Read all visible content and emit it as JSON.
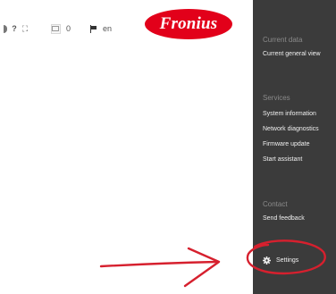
{
  "header": {
    "toolbar": {
      "help_label": "?",
      "fullscreen_label": "⛶",
      "message_count": "0",
      "language_label": "en"
    },
    "logo_text": "Fronius",
    "brand_color": "#e2001a"
  },
  "sidebar": {
    "sections": [
      {
        "caption": "Current data",
        "items": [
          "Current general view"
        ]
      },
      {
        "caption": "Services",
        "items": [
          "System information",
          "Network diagnostics",
          "Firmware update",
          "Start assistant"
        ]
      },
      {
        "caption": "Contact",
        "items": [
          "Send feedback"
        ]
      }
    ],
    "settings_label": "Settings"
  },
  "annotation_color": "#d6202e"
}
